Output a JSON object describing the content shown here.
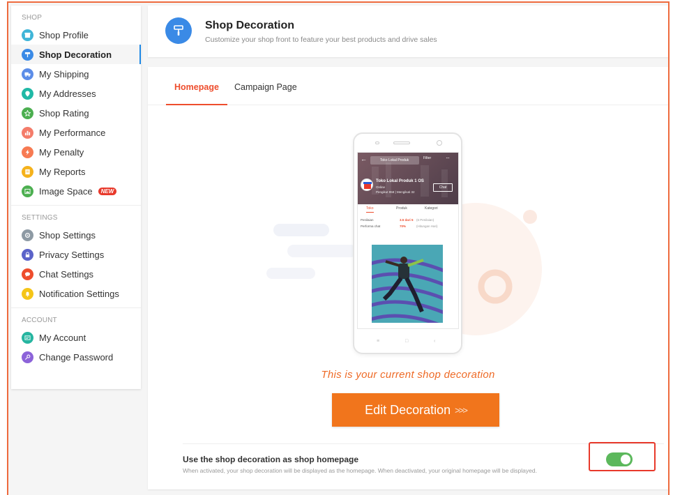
{
  "sidebar": {
    "sections": [
      {
        "title": "SHOP",
        "items": [
          {
            "label": "Shop Profile",
            "icon": "store-icon",
            "color": "#3fb5d8"
          },
          {
            "label": "Shop Decoration",
            "icon": "paint-roller-icon",
            "color": "#3a8ae6",
            "active": true
          },
          {
            "label": "My Shipping",
            "icon": "truck-icon",
            "color": "#5c8de8"
          },
          {
            "label": "My Addresses",
            "icon": "location-pin-icon",
            "color": "#20b9a6"
          },
          {
            "label": "Shop Rating",
            "icon": "star-icon",
            "color": "#4caf50"
          },
          {
            "label": "My Performance",
            "icon": "chart-icon",
            "color": "#f47c6a"
          },
          {
            "label": "My Penalty",
            "icon": "lightning-icon",
            "color": "#f77a52"
          },
          {
            "label": "My Reports",
            "icon": "report-icon",
            "color": "#f5b21c"
          },
          {
            "label": "Image Space",
            "icon": "image-icon",
            "color": "#4caf50",
            "badge": "NEW"
          }
        ]
      },
      {
        "title": "SETTINGS",
        "items": [
          {
            "label": "Shop Settings",
            "icon": "gear-icon",
            "color": "#8e9aa4"
          },
          {
            "label": "Privacy Settings",
            "icon": "lock-icon",
            "color": "#5b63c9"
          },
          {
            "label": "Chat Settings",
            "icon": "chat-icon",
            "color": "#ee4d2d"
          },
          {
            "label": "Notification Settings",
            "icon": "bell-icon",
            "color": "#f5c518"
          }
        ]
      },
      {
        "title": "ACCOUNT",
        "items": [
          {
            "label": "My Account",
            "icon": "id-card-icon",
            "color": "#26b5a0"
          },
          {
            "label": "Change Password",
            "icon": "key-icon",
            "color": "#8c63d9"
          }
        ]
      }
    ]
  },
  "header": {
    "title": "Shop Decoration",
    "subtitle": "Customize your shop front to feature your best products and drive sales",
    "icon": "paint-roller-icon",
    "icon_color": "#3a8ae6"
  },
  "tabs": [
    {
      "label": "Homepage",
      "active": true
    },
    {
      "label": "Campaign Page",
      "active": false
    }
  ],
  "preview": {
    "search_placeholder": "Toko Lokal Produk",
    "filter_label": "Filter",
    "shop_name": "Toko Lokal Produk 1 OS",
    "status": "Online",
    "followers": "Pengikut 958 | Mengikuti 32",
    "chat_label": "Chat",
    "mini_tabs": [
      "Toko",
      "Produk",
      "Kategori"
    ],
    "rows": [
      {
        "label": "Penilaian",
        "value": "3.5 dari 5",
        "sub": "(6 Penilaian)"
      },
      {
        "label": "Performa chat",
        "value": "70%",
        "sub": "(Hitungan Hari)"
      }
    ]
  },
  "caption": "This is your current shop decoration",
  "edit_button": {
    "label": "Edit Decoration",
    "arrows": ">>>"
  },
  "toggle_setting": {
    "title": "Use the shop decoration as shop homepage",
    "description": "When activated, your shop decoration will be displayed as the homepage. When deactivated, your original homepage will be displayed.",
    "enabled": true,
    "on_color": "#5cb85c"
  },
  "colors": {
    "accent": "#ee4d2d",
    "button": "#f1751c",
    "highlight": "#e8392b"
  }
}
